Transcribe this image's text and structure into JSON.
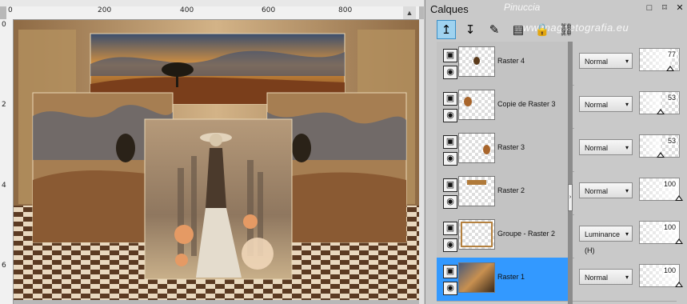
{
  "canvas": {
    "ruler_top_labels": [
      "0",
      "200",
      "400",
      "600",
      "800"
    ],
    "ruler_left_labels": [
      "0",
      "2",
      "4",
      "6"
    ]
  },
  "panel": {
    "title": "Calques",
    "watermark_top": "Pinuccia",
    "watermark_bottom": "www.magnetografia.eu",
    "controls": [
      "□",
      "⌑",
      "✕"
    ],
    "toolbar": [
      {
        "icon": "pin-up-icon",
        "glyph": "↥",
        "active": true
      },
      {
        "icon": "pin-down-icon",
        "glyph": "↧",
        "active": false
      },
      {
        "icon": "brush-icon",
        "glyph": "✎",
        "active": false
      },
      {
        "icon": "film-icon",
        "glyph": "▤",
        "active": false
      },
      {
        "icon": "lock-icon",
        "glyph": "🔒",
        "active": false
      },
      {
        "icon": "link-icon",
        "glyph": "⛓",
        "active": false
      }
    ]
  },
  "layers": [
    {
      "name": "Raster 4",
      "blend": "Normal",
      "opacity": 77,
      "selected": false
    },
    {
      "name": "Copie de Raster 3",
      "blend": "Normal",
      "opacity": 53,
      "selected": false
    },
    {
      "name": "Raster 3",
      "blend": "Normal",
      "opacity": 53,
      "selected": false
    },
    {
      "name": "Raster 2",
      "blend": "Normal",
      "opacity": 100,
      "selected": false
    },
    {
      "name": "Groupe - Raster 2",
      "blend": "Luminance (H)",
      "opacity": 100,
      "selected": false
    },
    {
      "name": "Raster 1",
      "blend": "Normal",
      "opacity": 100,
      "selected": true
    }
  ],
  "colors": {
    "selected_row": "#3399ff",
    "toolbar_active": "#9fd2ef"
  }
}
